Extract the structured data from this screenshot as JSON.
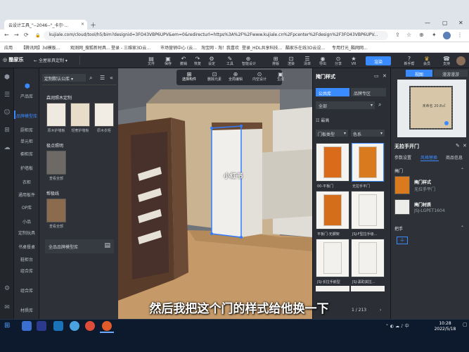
{
  "browser": {
    "tab_title": "云设计工具_\"--2046--\"_卡尔·...",
    "url": "kujiale.com/cloud/tool/h5/bim?designid=3FO43VBP6UPV&em=0&redirecturl=https%3A%2F%2Fwww.kujiale.cn%2Fpcenter%2Fdesign%2F3FO43VBP6UPV...",
    "bookmarks": [
      "应用",
      "【腾讯网】3d模板...",
      "观测网_搜狐新材具...",
      "登录 - 三维家3D云...",
      "市场营销中心 (云...",
      "淘宝网 - 淘！我喜欢",
      "登录_HDL共享科技...",
      "酷家乐在线3D云设...",
      "专用打光_酷网网..."
    ]
  },
  "app": {
    "logo": "酷家乐",
    "library_select": "全屋家具定制",
    "tools": [
      {
        "icon": "▤",
        "label": "文件"
      },
      {
        "icon": "▣",
        "label": "保存"
      },
      {
        "icon": "↶",
        "label": "撤销"
      },
      {
        "icon": "↷",
        "label": "恢复"
      },
      {
        "icon": "⚙",
        "label": "设定"
      },
      {
        "icon": "✎",
        "label": "工具"
      },
      {
        "icon": "⊕",
        "label": "智能设计"
      },
      {
        "icon": "⊞",
        "label": "排版"
      },
      {
        "icon": "⊡",
        "label": "渲染"
      },
      {
        "icon": "☰",
        "label": "清单"
      },
      {
        "icon": "◉",
        "label": "导出"
      },
      {
        "icon": "⊙",
        "label": "分享"
      },
      {
        "icon": "★",
        "label": "VR"
      }
    ],
    "render_button": "渲染",
    "user_buttons": [
      "新手帮",
      "会员",
      "支持"
    ]
  },
  "categories": [
    {
      "label": "产品库",
      "active": false
    },
    {
      "label": "品牌模型库",
      "active": true
    },
    {
      "label": "厨柜库",
      "active": false
    },
    {
      "label": "单元柜",
      "active": false
    },
    {
      "label": "橱柜库",
      "active": false
    },
    {
      "label": "护墙板",
      "active": false
    },
    {
      "label": "衣柜",
      "active": false
    },
    {
      "label": "通用板件",
      "active": false
    },
    {
      "label": "OP库",
      "active": false
    },
    {
      "label": "小品",
      "active": false
    },
    {
      "label": "定制玩具",
      "active": false
    },
    {
      "label": "书桌餐桌",
      "active": false
    },
    {
      "label": "鞋柜台",
      "active": false
    },
    {
      "label": "组合库",
      "active": false
    },
    {
      "label": "组合库",
      "active": false
    },
    {
      "label": "材质库",
      "active": false
    }
  ],
  "library": {
    "header": "定制默认公库",
    "section1": "森润照木定制",
    "items1": [
      {
        "label": "原木护墙板"
      },
      {
        "label": "轻奢护墙板"
      },
      {
        "label": "原木衣柜"
      }
    ],
    "section2": "极点照明",
    "items2": [
      {
        "label": "查看全部"
      }
    ],
    "section3": "帮极线",
    "items3": [
      {
        "label": "查看全部"
      }
    ],
    "footer": "全品品牌模型库"
  },
  "viewport_toolbar": [
    {
      "icon": "⊞",
      "label": "选择构件"
    },
    {
      "icon": "⊡",
      "label": "删除元素"
    },
    {
      "icon": "⊕",
      "label": "全局编辑"
    },
    {
      "icon": "⊙",
      "label": "内空设计"
    },
    {
      "icon": "▣",
      "label": "生成"
    }
  ],
  "watermark": "小红书",
  "door_panel": {
    "title": "掩门样式",
    "tabs": [
      "公共库",
      "品牌专区"
    ],
    "filter_all": "全部",
    "sort": "最高",
    "filters": [
      "门板类型",
      "色系"
    ],
    "items": [
      {
        "label": "00-平板门",
        "color": "#d96b1a"
      },
      {
        "label": "无拉手平门",
        "color": "#d97a1f"
      },
      {
        "label": "平板门-无脚架",
        "color": "#d56e1a"
      },
      {
        "label": "JSJ-F型拉手级...",
        "color": "#f3f1ed"
      },
      {
        "label": "JSJ-长拉手嵌型",
        "color": "#f3f1ed"
      },
      {
        "label": "JSJ-黑助其拉...",
        "color": "#f3f1ed"
      }
    ],
    "pagination": "1 / 213"
  },
  "right_panel": {
    "title": "无拉手开门",
    "tabs": [
      "参数设置",
      "风格替换",
      "商品信息"
    ],
    "section_door": "掩门",
    "entries": [
      {
        "name": "掩门样式",
        "value": "无拉手平门"
      },
      {
        "name": "掩门材质",
        "value": "JSJ-LGPET1604"
      }
    ],
    "section_handle": "把手",
    "floorplan_label": "未命名 20.8㎡",
    "view_tabs": [
      "视图",
      "漫游漫游"
    ]
  },
  "subtitle": "然后我把这个门的样式给他换一下",
  "taskbar": {
    "time": "10:28",
    "date": "2022/5/18"
  },
  "colors": {
    "accent": "#3a8bff",
    "panel": "#2e3137",
    "door_orange": "#d96b1a"
  }
}
